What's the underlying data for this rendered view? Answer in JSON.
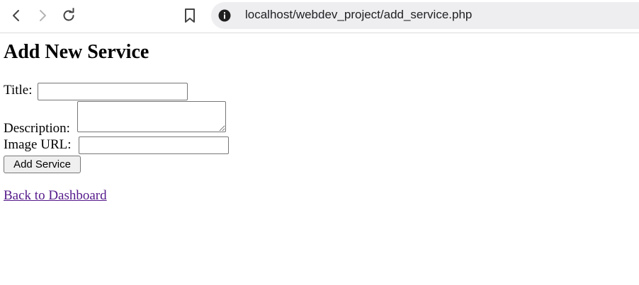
{
  "browser": {
    "url": "localhost/webdev_project/add_service.php"
  },
  "page": {
    "heading": "Add New Service",
    "form": {
      "title_label": "Title:",
      "title_value": "",
      "description_label": "Description:",
      "description_value": "",
      "image_url_label": "Image URL:",
      "image_url_value": "",
      "submit_label": "Add Service"
    },
    "back_link": "Back to Dashboard"
  },
  "colors": {
    "link_visited": "#551a8b",
    "address_bar_bg": "#eeeef1"
  }
}
